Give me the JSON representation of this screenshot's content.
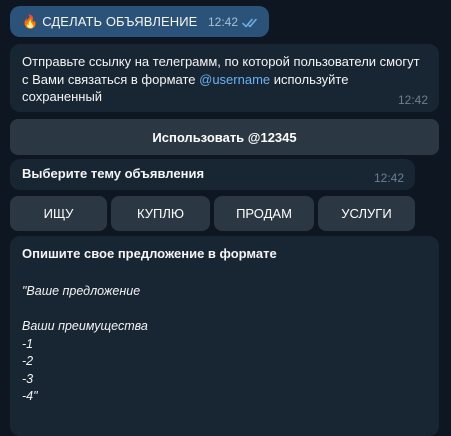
{
  "messages": {
    "outgoing": {
      "icon": "🔥",
      "text": "СДЕЛАТЬ ОБЪЯВЛЕНИЕ",
      "time": "12:42"
    },
    "link_prompt": {
      "text_before": "Отправьте ссылку на телеграмм, по которой пользователи смогут с Вами связаться в формате ",
      "handle": "@username",
      "text_after": " используйте сохраненный",
      "time": "12:42"
    },
    "topic_prompt": {
      "text": "Выберите тему объявления",
      "time": "12:42"
    },
    "offer_prompt": {
      "title": "Опишите свое предложение в формате",
      "line1": "\"Ваше предложение",
      "line2": "Ваши преимущества",
      "line3": "-1",
      "line4": "-2",
      "line5": "-3",
      "line6": "-4\""
    }
  },
  "buttons": {
    "use_saved": "Использовать @12345",
    "options": [
      "ИЩУ",
      "КУПЛЮ",
      "ПРОДАМ",
      "УСЛУГИ"
    ]
  },
  "colors": {
    "background": "#0e1621",
    "incoming_bubble": "#182533",
    "outgoing_bubble": "#2b5278",
    "button": "#2b3843",
    "link": "#6ab3f3"
  },
  "icons": {
    "fire": "fire-icon",
    "read": "double-check-icon"
  }
}
